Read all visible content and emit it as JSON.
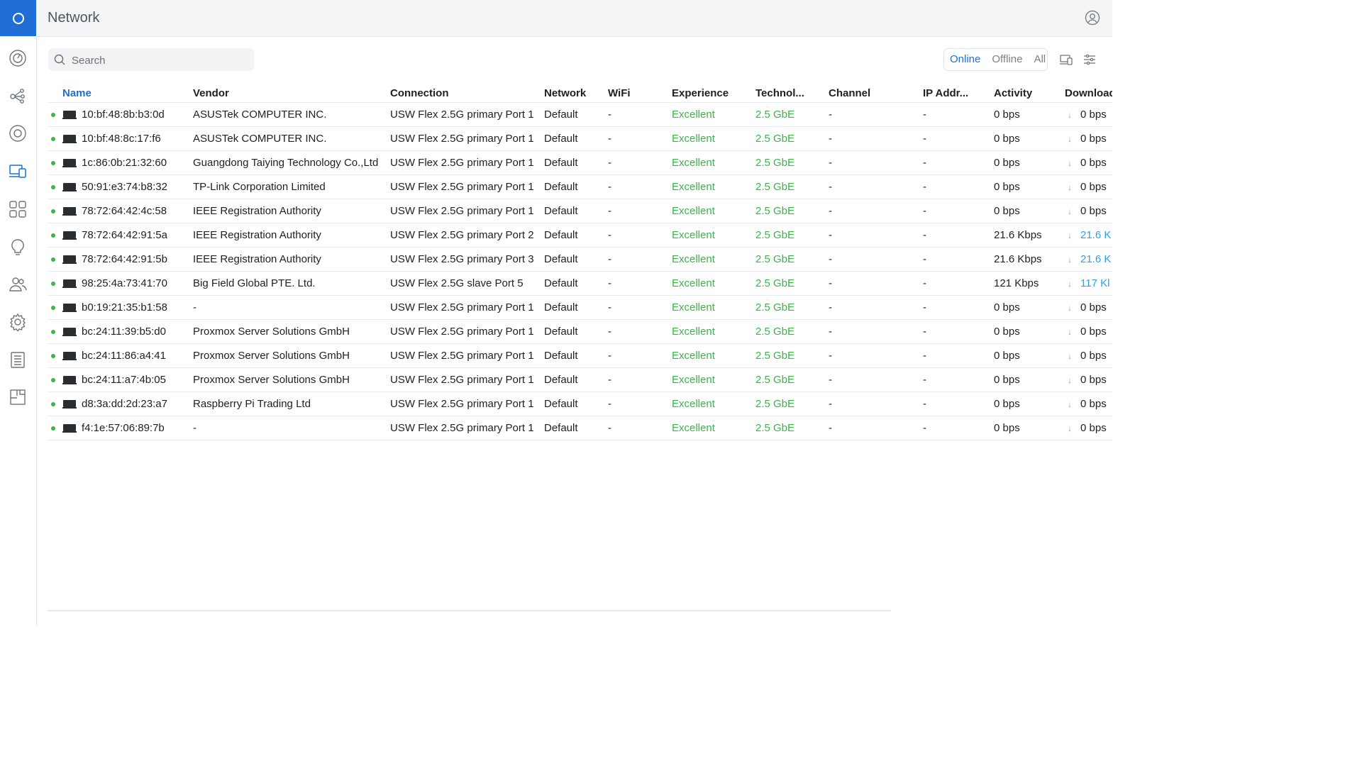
{
  "app": {
    "title": "Network"
  },
  "colors": {
    "accent": "#1f6fd6",
    "good": "#3bb44a",
    "activity": "#29a3e6"
  },
  "sidebar": {
    "items": [
      {
        "icon": "dashboard-icon"
      },
      {
        "icon": "topology-icon"
      },
      {
        "icon": "devices-icon"
      },
      {
        "icon": "client-devices-icon",
        "active": true
      },
      {
        "icon": "ports-icon"
      },
      {
        "icon": "insights-icon"
      },
      {
        "icon": "users-icon"
      },
      {
        "icon": "settings-icon"
      },
      {
        "icon": "logs-icon"
      },
      {
        "icon": "floorplan-icon"
      }
    ]
  },
  "search": {
    "placeholder": "Search"
  },
  "filters": {
    "online": "Online",
    "offline": "Offline",
    "all": "All",
    "selected": "Online"
  },
  "table": {
    "columns": [
      "Name",
      "Vendor",
      "Connection",
      "Network",
      "WiFi",
      "Experience",
      "Technol...",
      "Channel",
      "IP Addr...",
      "Activity",
      "Download"
    ],
    "sorted_column": "Name",
    "rows": [
      {
        "name": "10:bf:48:8b:b3:0d",
        "vendor": "ASUSTek COMPUTER INC.",
        "connection": "USW Flex 2.5G primary Port 1",
        "network": "Default",
        "wifi": "-",
        "experience": "Excellent",
        "technology": "2.5 GbE",
        "channel": "-",
        "ip": "-",
        "activity": "0 bps",
        "download": "0 bps"
      },
      {
        "name": "10:bf:48:8c:17:f6",
        "vendor": "ASUSTek COMPUTER INC.",
        "connection": "USW Flex 2.5G primary Port 1",
        "network": "Default",
        "wifi": "-",
        "experience": "Excellent",
        "technology": "2.5 GbE",
        "channel": "-",
        "ip": "-",
        "activity": "0 bps",
        "download": "0 bps"
      },
      {
        "name": "1c:86:0b:21:32:60",
        "vendor": "Guangdong Taiying Technology Co.,Ltd",
        "connection": "USW Flex 2.5G primary Port 1",
        "network": "Default",
        "wifi": "-",
        "experience": "Excellent",
        "technology": "2.5 GbE",
        "channel": "-",
        "ip": "-",
        "activity": "0 bps",
        "download": "0 bps"
      },
      {
        "name": "50:91:e3:74:b8:32",
        "vendor": "TP-Link Corporation Limited",
        "connection": "USW Flex 2.5G primary Port 1",
        "network": "Default",
        "wifi": "-",
        "experience": "Excellent",
        "technology": "2.5 GbE",
        "channel": "-",
        "ip": "-",
        "activity": "0 bps",
        "download": "0 bps"
      },
      {
        "name": "78:72:64:42:4c:58",
        "vendor": "IEEE Registration Authority",
        "connection": "USW Flex 2.5G primary Port 1",
        "network": "Default",
        "wifi": "-",
        "experience": "Excellent",
        "technology": "2.5 GbE",
        "channel": "-",
        "ip": "-",
        "activity": "0 bps",
        "download": "0 bps"
      },
      {
        "name": "78:72:64:42:91:5a",
        "vendor": "IEEE Registration Authority",
        "connection": "USW Flex 2.5G primary Port 2",
        "network": "Default",
        "wifi": "-",
        "experience": "Excellent",
        "technology": "2.5 GbE",
        "channel": "-",
        "ip": "-",
        "activity": "21.6 Kbps",
        "download": "21.6 K",
        "download_active": true
      },
      {
        "name": "78:72:64:42:91:5b",
        "vendor": "IEEE Registration Authority",
        "connection": "USW Flex 2.5G primary Port 3",
        "network": "Default",
        "wifi": "-",
        "experience": "Excellent",
        "technology": "2.5 GbE",
        "channel": "-",
        "ip": "-",
        "activity": "21.6 Kbps",
        "download": "21.6 K",
        "download_active": true
      },
      {
        "name": "98:25:4a:73:41:70",
        "vendor": "Big Field Global PTE. Ltd.",
        "connection": "USW Flex 2.5G slave Port 5",
        "network": "Default",
        "wifi": "-",
        "experience": "Excellent",
        "technology": "2.5 GbE",
        "channel": "-",
        "ip": "-",
        "activity": "121 Kbps",
        "download": "117 Kl",
        "download_active": true
      },
      {
        "name": "b0:19:21:35:b1:58",
        "vendor": "-",
        "connection": "USW Flex 2.5G primary Port 1",
        "network": "Default",
        "wifi": "-",
        "experience": "Excellent",
        "technology": "2.5 GbE",
        "channel": "-",
        "ip": "-",
        "activity": "0 bps",
        "download": "0 bps"
      },
      {
        "name": "bc:24:11:39:b5:d0",
        "vendor": "Proxmox Server Solutions GmbH",
        "connection": "USW Flex 2.5G primary Port 1",
        "network": "Default",
        "wifi": "-",
        "experience": "Excellent",
        "technology": "2.5 GbE",
        "channel": "-",
        "ip": "-",
        "activity": "0 bps",
        "download": "0 bps"
      },
      {
        "name": "bc:24:11:86:a4:41",
        "vendor": "Proxmox Server Solutions GmbH",
        "connection": "USW Flex 2.5G primary Port 1",
        "network": "Default",
        "wifi": "-",
        "experience": "Excellent",
        "technology": "2.5 GbE",
        "channel": "-",
        "ip": "-",
        "activity": "0 bps",
        "download": "0 bps"
      },
      {
        "name": "bc:24:11:a7:4b:05",
        "vendor": "Proxmox Server Solutions GmbH",
        "connection": "USW Flex 2.5G primary Port 1",
        "network": "Default",
        "wifi": "-",
        "experience": "Excellent",
        "technology": "2.5 GbE",
        "channel": "-",
        "ip": "-",
        "activity": "0 bps",
        "download": "0 bps"
      },
      {
        "name": "d8:3a:dd:2d:23:a7",
        "vendor": "Raspberry Pi Trading Ltd",
        "connection": "USW Flex 2.5G primary Port 1",
        "network": "Default",
        "wifi": "-",
        "experience": "Excellent",
        "technology": "2.5 GbE",
        "channel": "-",
        "ip": "-",
        "activity": "0 bps",
        "download": "0 bps"
      },
      {
        "name": "f4:1e:57:06:89:7b",
        "vendor": "-",
        "connection": "USW Flex 2.5G primary Port 1",
        "network": "Default",
        "wifi": "-",
        "experience": "Excellent",
        "technology": "2.5 GbE",
        "channel": "-",
        "ip": "-",
        "activity": "0 bps",
        "download": "0 bps"
      }
    ]
  }
}
